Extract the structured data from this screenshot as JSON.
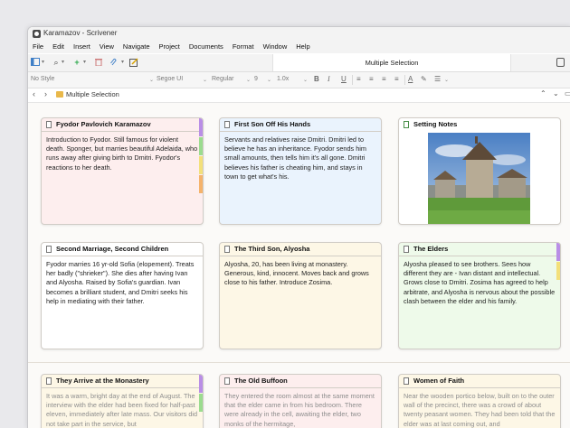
{
  "window": {
    "title": "Karamazov - Scrivener"
  },
  "menu": [
    "File",
    "Edit",
    "Insert",
    "View",
    "Navigate",
    "Project",
    "Documents",
    "Format",
    "Window",
    "Help"
  ],
  "toolbar": {
    "center_title": "Multiple Selection"
  },
  "format_bar": {
    "style": "No Style",
    "font": "Segoe UI",
    "weight": "Regular",
    "size": "9",
    "spacing": "1.0x"
  },
  "nav": {
    "breadcrumb": "Multiple Selection"
  },
  "colors": {
    "purple": "#b98ee6",
    "green": "#9bdc8f",
    "yellow": "#f3e07a",
    "orange": "#f5b36b",
    "card_pink": "#fdeeee",
    "card_blue": "#eaf3fd",
    "card_white": "#ffffff",
    "card_cream": "#fdf7e6",
    "card_green": "#eefaea"
  },
  "cards": [
    {
      "title": "Fyodor Pavlovich  Karamazov",
      "body": "Introduction to Fyodor. Still famous for violent death. Sponger, but marries beautiful Adelaida, who runs away after giving birth to Dmitri. Fyodor's reactions to her death."
    },
    {
      "title": "First Son Off His Hands",
      "body": "Servants and relatives raise Dmitri. Dmitri led to believe he has an inheritance. Fyodor sends him small amounts, then tells him it's all gone. Dmitri believes his father is cheating him, and stays in town to get what's his."
    },
    {
      "title": "Setting Notes",
      "body": ""
    },
    {
      "title": "Second Marriage, Second Children",
      "body": "Fyodor marries 16 yr-old Sofia (elopement). Treats her badly (\"shrieker\"). She dies after having Ivan and Alyosha. Raised by Sofia's guardian. Ivan becomes a brilliant student, and Dmitri seeks his help in mediating with their father."
    },
    {
      "title": "The Third Son, Alyosha",
      "body": "Alyosha, 20, has been living at monastery. Generous, kind, innocent. Moves back and grows close to his father. Introduce Zosima."
    },
    {
      "title": "The Elders",
      "body": "Alyosha pleased to see brothers. Sees how different they are - Ivan distant and intellectual. Grows close to Dmitri. Zosima has agreed to help arbitrate, and Alyosha is nervous about the possible clash between the elder and his family."
    },
    {
      "title": "They Arrive at the Monastery",
      "body": "It was a warm, bright day at the end of August. The interview with the elder had been fixed for half-past eleven, immediately after late mass. Our visitors did not take part in the service, but"
    },
    {
      "title": "The Old Buffoon",
      "body": "They entered the room almost at the same moment that the elder came in from his bedroom. There were already in the cell, awaiting the elder, two monks of the hermitage,"
    },
    {
      "title": "Women of Faith",
      "body": "Near the wooden portico below, built on to the outer wall of the precinct, there was a crowd of about twenty peasant women. They had been told that the elder was at last coming out, and"
    }
  ]
}
